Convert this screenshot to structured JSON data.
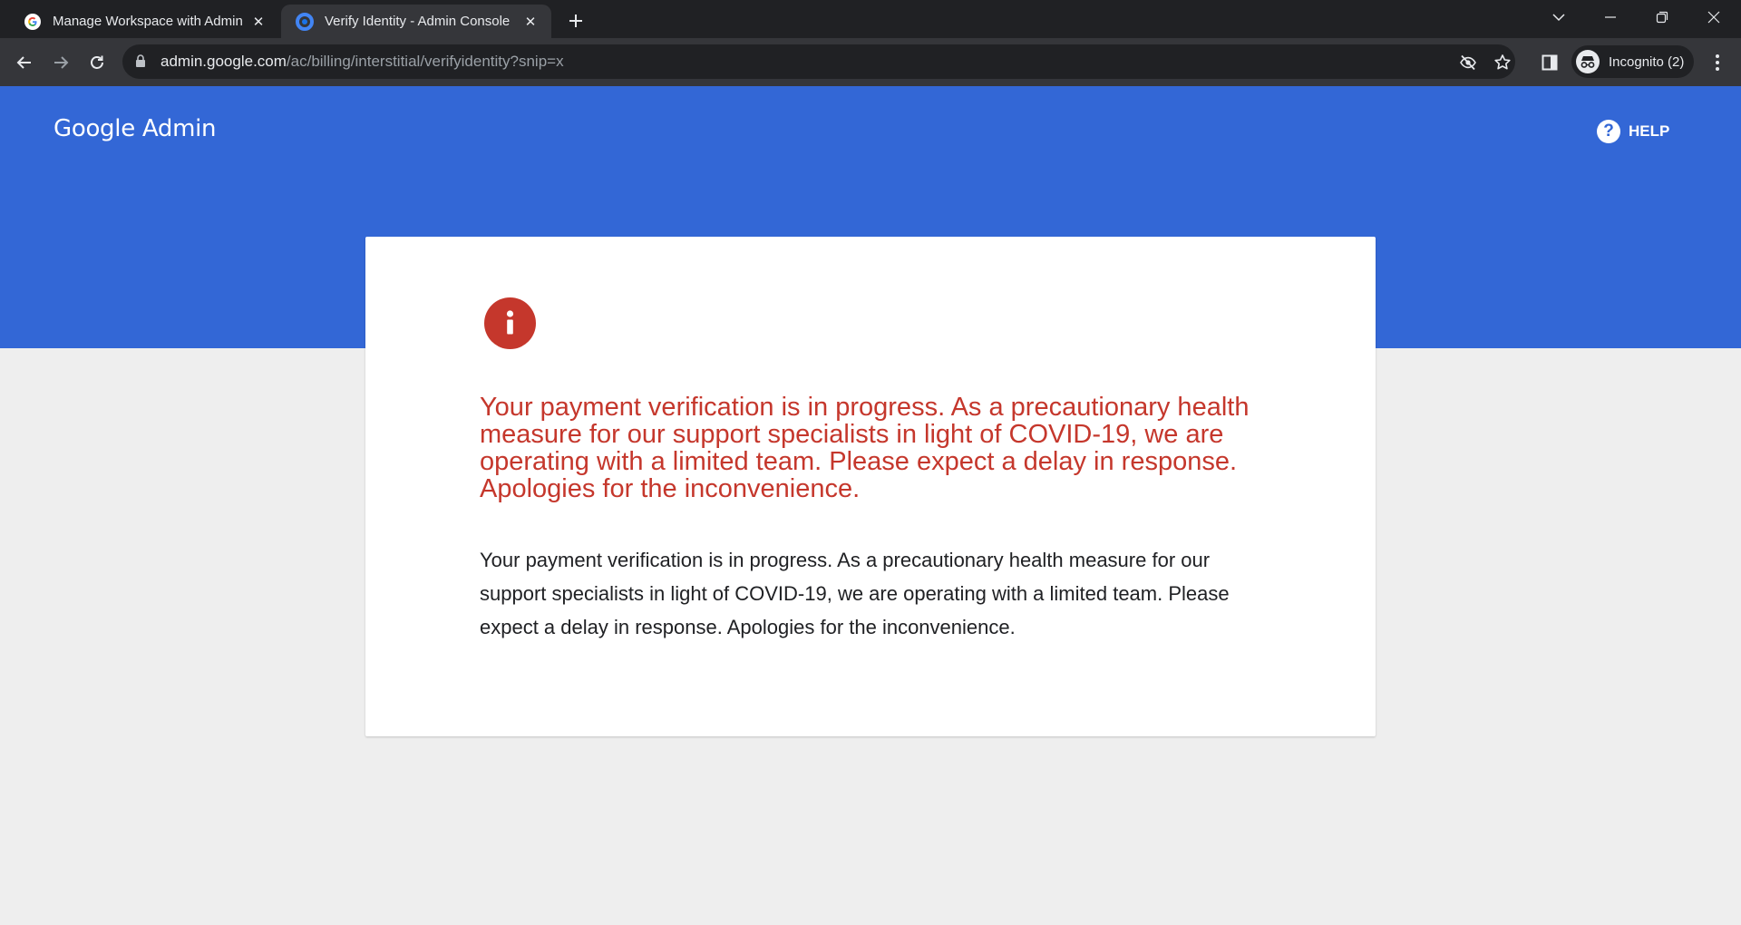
{
  "browser": {
    "tabs": [
      {
        "title": "Manage Workspace with Admin",
        "favicon": "google-g-icon",
        "active": false
      },
      {
        "title": "Verify Identity - Admin Console",
        "favicon": "admin-console-icon",
        "active": true
      }
    ],
    "url": {
      "host": "admin.google.com",
      "path": "/ac/billing/interstitial/verifyidentity?snip=x"
    },
    "profile_label": "Incognito (2)"
  },
  "header": {
    "logo_text": "Google Admin",
    "help_label": "HELP",
    "background_color": "#3367d6"
  },
  "notice": {
    "icon": "info-alert-icon",
    "icon_color": "#c5372c",
    "heading": "Your payment verification is in progress. As a precautionary health measure for our support specialists in light of COVID-19, we are operating with a limited team. Please expect a delay in response. Apologies for the inconvenience.",
    "body": "Your payment verification is in progress. As a precautionary health measure for our support specialists in light of COVID-19, we are operating with a limited team. Please expect a delay in response. Apologies for the inconvenience."
  }
}
